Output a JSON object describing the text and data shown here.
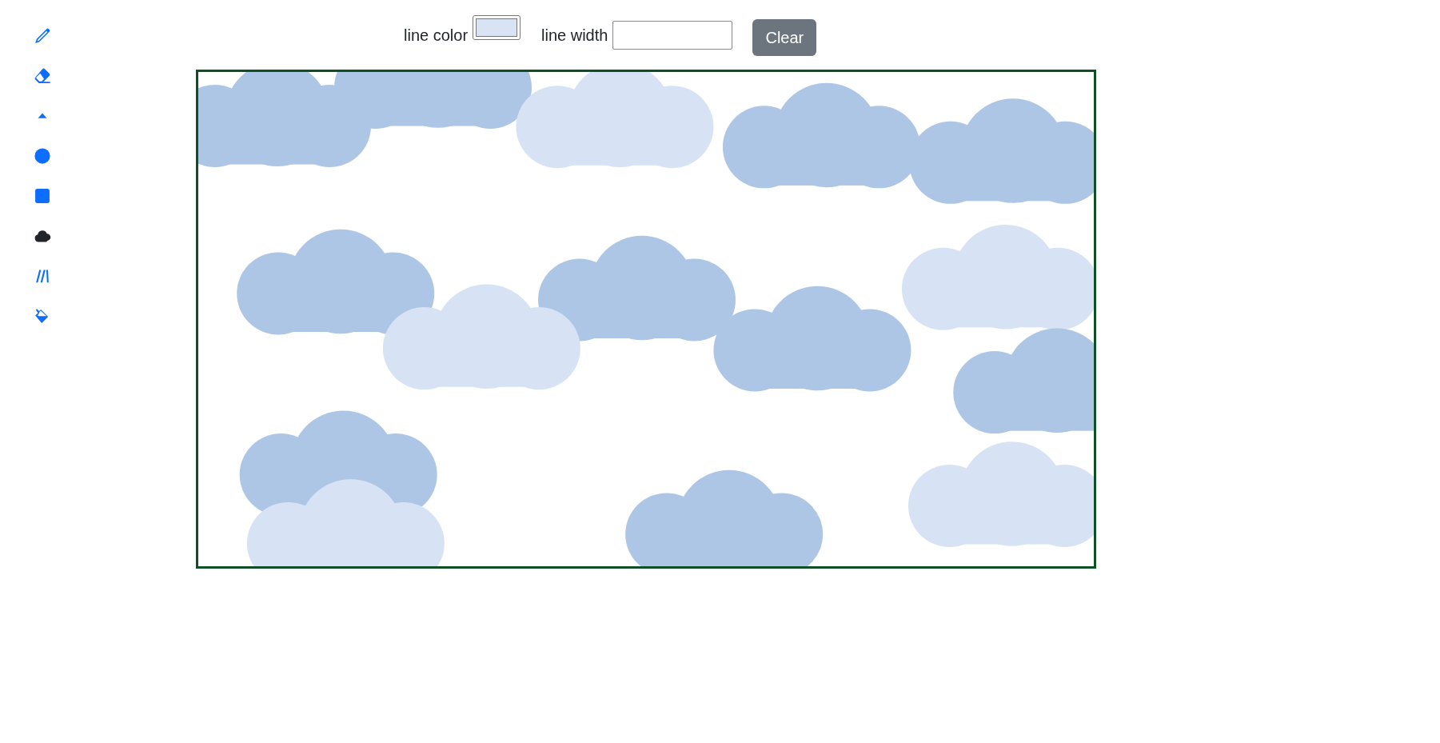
{
  "tools": [
    {
      "kind": "pencil",
      "selected": false
    },
    {
      "kind": "eraser",
      "selected": false
    },
    {
      "kind": "triangle",
      "selected": false
    },
    {
      "kind": "circle",
      "selected": false
    },
    {
      "kind": "square",
      "selected": false
    },
    {
      "kind": "cloud",
      "selected": true
    },
    {
      "kind": "lines",
      "selected": false
    },
    {
      "kind": "fill",
      "selected": false
    }
  ],
  "controls": {
    "line_color_label": "line color",
    "line_width_label": "line width",
    "clear_button": "Clear"
  }
}
